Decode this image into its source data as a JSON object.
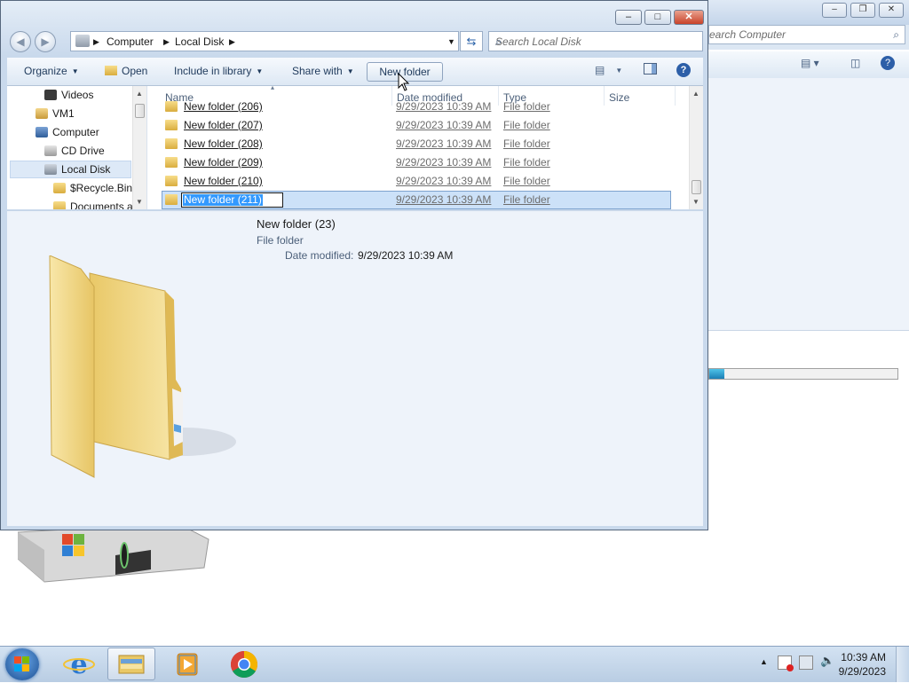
{
  "background_window": {
    "search_placeholder": "earch Computer",
    "progress_fraction": 0.08
  },
  "explorer": {
    "caption_buttons": {
      "minimize": "–",
      "maximize": "□",
      "close": "✕"
    },
    "breadcrumb": [
      "Computer",
      "Local Disk"
    ],
    "search_placeholder": "Search Local Disk",
    "toolbar": {
      "organize": "Organize",
      "open": "Open",
      "include_in_library": "Include in library",
      "share_with": "Share with",
      "new_folder": "New folder"
    },
    "nav_pane": {
      "items": [
        {
          "label": "Videos",
          "icon": "video-library-icon"
        },
        {
          "label": "VM1",
          "icon": "user-icon"
        },
        {
          "label": "Computer",
          "icon": "computer-icon"
        },
        {
          "label": "CD Drive",
          "icon": "cd-drive-icon"
        },
        {
          "label": "Local Disk",
          "icon": "hard-drive-icon"
        },
        {
          "label": "$Recycle.Bin",
          "icon": "folder-icon"
        },
        {
          "label": "Documents a",
          "icon": "folder-icon"
        }
      ],
      "selected": "Local Disk"
    },
    "file_list": {
      "columns": [
        "Name",
        "Date modified",
        "Type",
        "Size"
      ],
      "rows": [
        {
          "name": "New folder (206)",
          "date": "9/29/2023 10:39 AM",
          "type": "File folder"
        },
        {
          "name": "New folder (207)",
          "date": "9/29/2023 10:39 AM",
          "type": "File folder"
        },
        {
          "name": "New folder (208)",
          "date": "9/29/2023 10:39 AM",
          "type": "File folder"
        },
        {
          "name": "New folder (209)",
          "date": "9/29/2023 10:39 AM",
          "type": "File folder"
        },
        {
          "name": "New folder (210)",
          "date": "9/29/2023 10:39 AM",
          "type": "File folder"
        },
        {
          "name": "New folder (211)",
          "date": "9/29/2023 10:39 AM",
          "type": "File folder",
          "renaming": true
        }
      ]
    },
    "details": {
      "name": "New folder (23)",
      "type": "File folder",
      "date_label": "Date modified:",
      "date_value": "9/29/2023 10:39 AM"
    }
  },
  "taskbar": {
    "items": [
      {
        "name": "internet-explorer-icon"
      },
      {
        "name": "windows-explorer-icon",
        "active": true
      },
      {
        "name": "media-player-icon"
      },
      {
        "name": "chrome-icon"
      }
    ],
    "clock_time": "10:39 AM",
    "clock_date": "9/29/2023"
  },
  "colors": {
    "accent": "#3399ff",
    "selection": "#cce1f8",
    "link_text": "#1e395b"
  }
}
